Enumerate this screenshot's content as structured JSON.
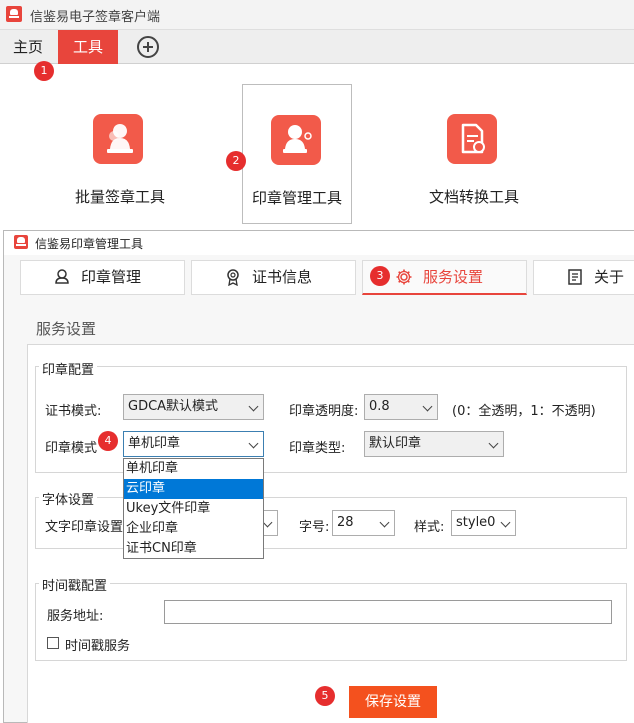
{
  "app": {
    "title": "信鉴易电子签章客户端"
  },
  "menu": {
    "home": "主页",
    "tools": "工具"
  },
  "tools": [
    {
      "label": "批量签章工具",
      "icon": "stamp-person-icon"
    },
    {
      "label": "印章管理工具",
      "icon": "seal-manage-icon"
    },
    {
      "label": "文档转换工具",
      "icon": "document-convert-icon"
    }
  ],
  "dialog": {
    "title": "信鉴易印章管理工具",
    "tabs": [
      {
        "label": "印章管理",
        "icon": "person-icon"
      },
      {
        "label": "证书信息",
        "icon": "certificate-icon"
      },
      {
        "label": "服务设置",
        "icon": "gear-icon"
      },
      {
        "label": "关于",
        "icon": "document-icon"
      }
    ],
    "section_title": "服务设置",
    "seal_config": {
      "legend": "印章配置",
      "cert_mode_label": "证书模式:",
      "cert_mode_value": "GDCA默认模式",
      "opacity_label": "印章透明度:",
      "opacity_value": "0.8",
      "opacity_hint": "(0：全透明，1：不透明)",
      "seal_mode_label": "印章模式",
      "seal_mode_value": "单机印章",
      "seal_type_label": "印章类型:",
      "seal_type_value": "默认印章",
      "seal_mode_options": [
        "单机印章",
        "云印章",
        "Ukey文件印章",
        "企业印章",
        "证书CN印章"
      ]
    },
    "font_settings": {
      "legend": "字体设置",
      "text_seal_label": "文字印章设置",
      "size_label": "字号:",
      "size_value": "28",
      "style_label": "样式:",
      "style_value": "style0"
    },
    "timestamp": {
      "legend": "时间戳配置",
      "service_addr_label": "服务地址:",
      "service_addr_value": "",
      "checkbox_label": "时间戳服务"
    },
    "save_button": "保存设置"
  },
  "badges": [
    "1",
    "2",
    "3",
    "4",
    "5"
  ],
  "colors": {
    "accent": "#e8453c",
    "save_button": "#f4511e",
    "highlight": "#0078d7"
  }
}
